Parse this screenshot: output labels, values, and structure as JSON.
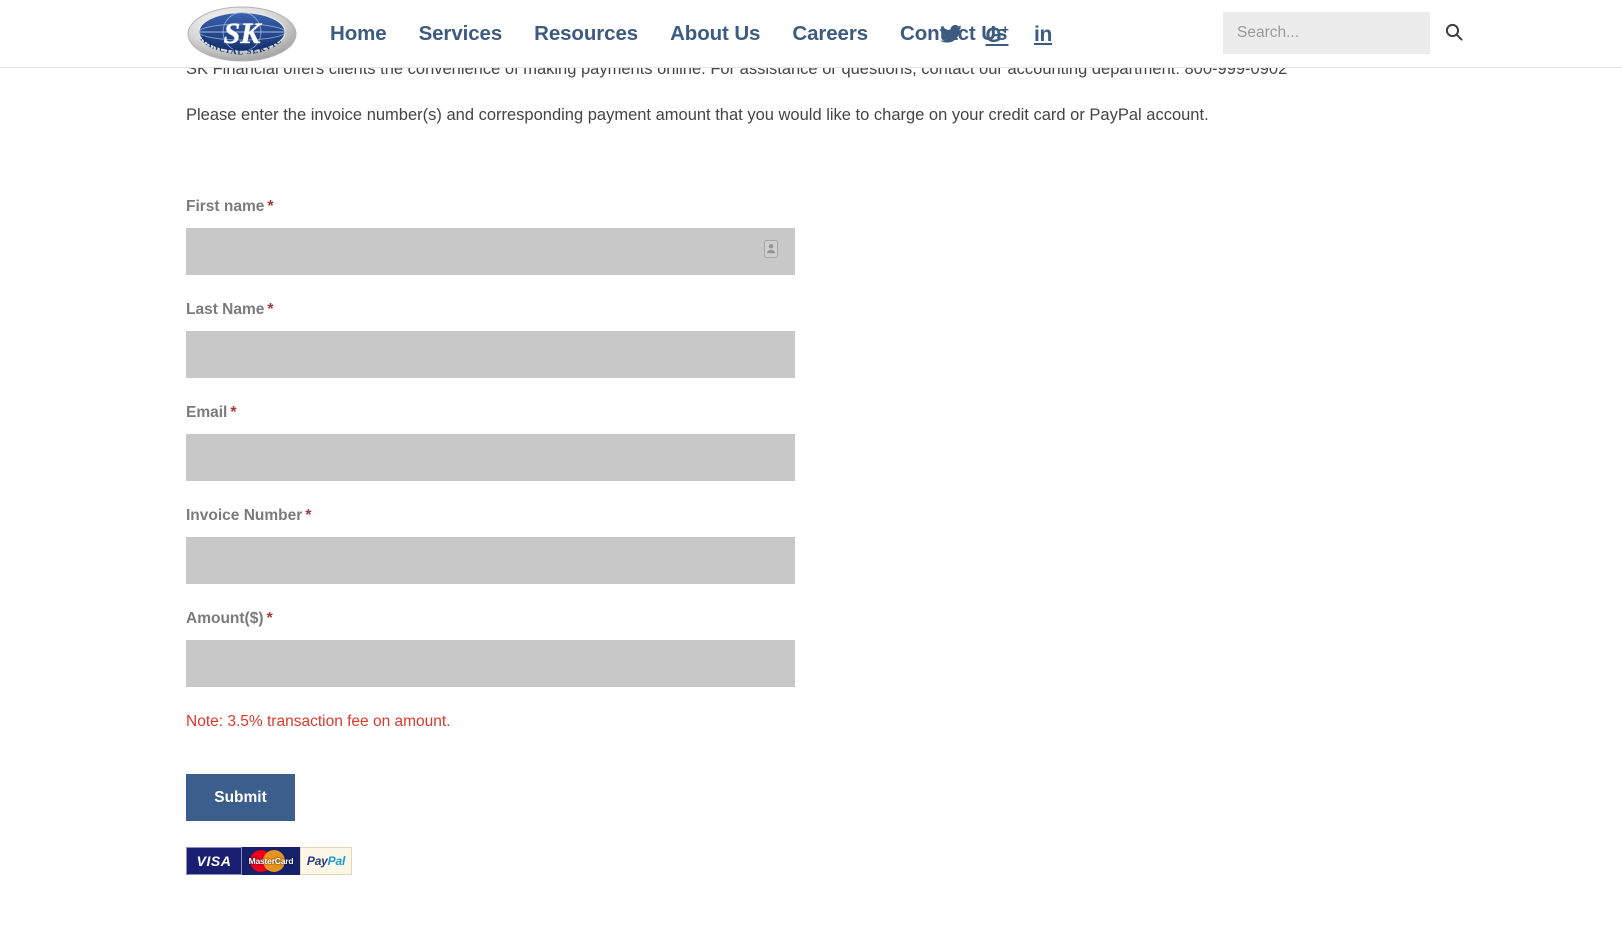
{
  "header": {
    "logo": {
      "name": "sk-financial-services-logo",
      "initials": "SK",
      "tagline": "FINANCIAL SERVICES"
    },
    "nav": [
      {
        "label": "Home",
        "name": "nav-home"
      },
      {
        "label": "Services",
        "name": "nav-services"
      },
      {
        "label": "Resources",
        "name": "nav-resources"
      },
      {
        "label": "About Us",
        "name": "nav-about-us"
      },
      {
        "label": "Careers",
        "name": "nav-careers"
      },
      {
        "label": "Contact Us",
        "name": "nav-contact-us"
      }
    ],
    "social": [
      {
        "name": "twitter-icon",
        "label": ""
      },
      {
        "name": "google-plus-icon",
        "label": "G"
      },
      {
        "name": "linkedin-icon",
        "label": "in"
      }
    ],
    "search": {
      "placeholder": "Search...",
      "value": "",
      "icon": "search-icon"
    },
    "accent_color": "#3d5a80"
  },
  "intro": {
    "line1": "SK Financial offers clients the convenience of making payments online. For assistance or questions, contact our accounting department: 800-999-0902",
    "line2": "Please enter the invoice number(s) and corresponding payment amount that you would like to charge on your credit card or PayPal account."
  },
  "form": {
    "required_marker": "*",
    "fields": [
      {
        "label": "First name",
        "name": "first-name",
        "value": "",
        "placeholder": "",
        "required": true,
        "has_autofill_icon": true
      },
      {
        "label": "Last Name",
        "name": "last-name",
        "value": "",
        "placeholder": "",
        "required": true,
        "has_autofill_icon": false
      },
      {
        "label": "Email",
        "name": "email",
        "value": "",
        "placeholder": "",
        "required": true,
        "has_autofill_icon": false
      },
      {
        "label": "Invoice Number",
        "name": "invoice-number",
        "value": "",
        "placeholder": "",
        "required": true,
        "has_autofill_icon": false
      },
      {
        "label": "Amount($)",
        "name": "amount",
        "value": "",
        "placeholder": "",
        "required": true,
        "has_autofill_icon": false
      }
    ],
    "note": "Note: 3.5% transaction fee on amount.",
    "note_color": "#d83a2b",
    "submit_label": "Submit",
    "submit_color": "#3b5e8c",
    "input_bg": "#c8c8c8"
  },
  "payment_logos": [
    {
      "name": "visa-logo",
      "label": "VISA"
    },
    {
      "name": "mastercard-logo",
      "label": "MasterCard"
    },
    {
      "name": "paypal-logo",
      "label": "PayPal",
      "label_head": "Pay",
      "label_tail": "Pal"
    }
  ]
}
